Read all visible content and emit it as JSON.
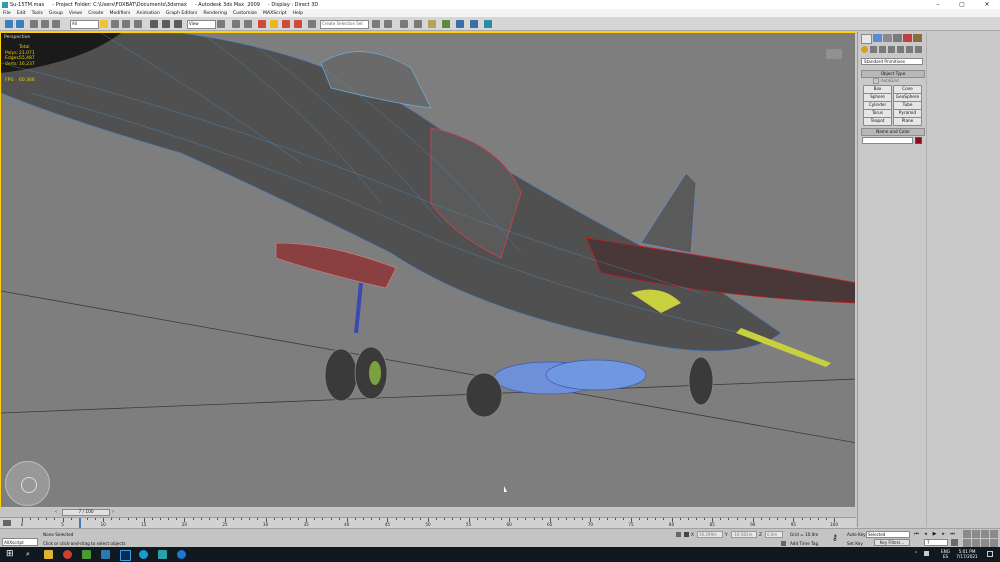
{
  "window": {
    "app_icon": "3dsmax-app-icon",
    "file": "Su-15TM.max",
    "project": "- Project Folder: C:\\Users\\FOXBAT\\Documents\\3dsmax",
    "app": "- Autodesk 3ds Max  2009",
    "display": "- Display : Direct 3D"
  },
  "menu": [
    "File",
    "Edit",
    "Tools",
    "Group",
    "Views",
    "Create",
    "Modifiers",
    "Animation",
    "Graph Editors",
    "Rendering",
    "Customize",
    "MAXScript",
    "Help"
  ],
  "toolbar": {
    "filter_value": "All",
    "refcoord_value": "View",
    "selection_set_placeholder": "Create Selection Set"
  },
  "viewport": {
    "label": "Perspective",
    "stats": {
      "title": "Total",
      "polys_label": "Polys:",
      "polys_value": "21,071",
      "edges_label": "Edges:",
      "edges_value": "55,487",
      "verts_label": "Verts:",
      "verts_value": "16,237",
      "fps_label": "FPS:",
      "fps_value": "60.366"
    }
  },
  "command_panel": {
    "dropdown_value": "Standard Primitives",
    "object_type_header": "Object Type",
    "autogrid_label": "AutoGrid",
    "buttons": [
      "Box",
      "Cone",
      "Sphere",
      "GeoSphere",
      "Cylinder",
      "Tube",
      "Torus",
      "Pyramid",
      "Teapot",
      "Plane"
    ],
    "name_color_header": "Name and Color",
    "color_swatch": "#8b0a1e"
  },
  "timeline": {
    "frame_display": "7 / 100",
    "ticks": [
      "0",
      "5",
      "10",
      "15",
      "20",
      "25",
      "30",
      "35",
      "40",
      "45",
      "50",
      "55",
      "60",
      "65",
      "70",
      "75",
      "80",
      "85",
      "90",
      "95",
      "100"
    ]
  },
  "status": {
    "maxscript_label": "AllXscript",
    "selection": "None Selected",
    "prompt": "Click or click-and-drag to select objects",
    "x_label": "X",
    "x_value": "16.299m",
    "y_label": "Y",
    "y_value": "-19.581m",
    "z_label": "Z",
    "z_value": "0.0m",
    "grid": "Grid = 10.0m",
    "add_time_tag": "Add Time Tag",
    "auto_key": "Auto Key",
    "set_key": "Set Key",
    "selected_value": "Selected",
    "key_filters": "Key Filters...",
    "frame_value": "7"
  },
  "taskbar": {
    "lang": "ENG",
    "locale": "ES",
    "time": "5:01 PM",
    "date": "7/17/2021",
    "apps": [
      "start-icon",
      "search-icon",
      "task-view-icon",
      "file-explorer-icon",
      "chrome-icon",
      "corel-icon",
      "photoshop-icon",
      "camera-icon",
      "3dsmax-icon",
      "edge-icon"
    ]
  },
  "colors": {
    "viewport_bg": "#7e7e7e",
    "active_viewport_border": "#ffd200",
    "stats_text": "#e8d200",
    "taskbar": "#101820"
  }
}
